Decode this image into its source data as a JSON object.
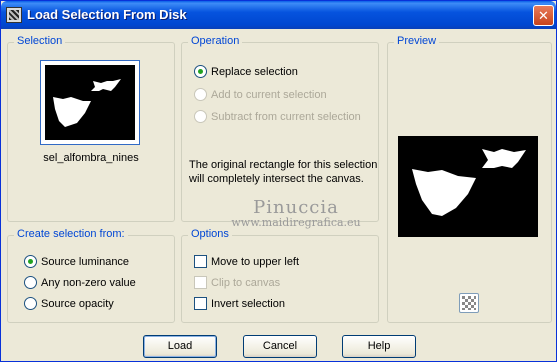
{
  "window": {
    "title": "Load Selection From Disk",
    "close_label": "✕"
  },
  "selection": {
    "title": "Selection",
    "filename": "sel_alfombra_nines"
  },
  "operation": {
    "title": "Operation",
    "options": [
      {
        "label": "Replace selection",
        "checked": true,
        "enabled": true
      },
      {
        "label": "Add to current selection",
        "checked": false,
        "enabled": false
      },
      {
        "label": "Subtract from current selection",
        "checked": false,
        "enabled": false
      }
    ],
    "info_line1": "The original rectangle for this selection",
    "info_line2": "will completely intersect the canvas."
  },
  "preview": {
    "title": "Preview"
  },
  "create_from": {
    "title": "Create selection from:",
    "options": [
      {
        "label": "Source luminance",
        "checked": true
      },
      {
        "label": "Any non-zero value",
        "checked": false
      },
      {
        "label": "Source opacity",
        "checked": false
      }
    ]
  },
  "options": {
    "title": "Options",
    "items": [
      {
        "label": "Move to upper left",
        "checked": false,
        "enabled": true
      },
      {
        "label": "Clip to canvas",
        "checked": false,
        "enabled": false
      },
      {
        "label": "Invert selection",
        "checked": false,
        "enabled": true
      }
    ]
  },
  "watermark": {
    "line1": "Pinuccia",
    "line2": "www.maidiregrafica.eu"
  },
  "buttons": {
    "load": "Load",
    "cancel": "Cancel",
    "help": "Help"
  },
  "colors": {
    "accent": "#0046d5",
    "titlebar": "#0653de",
    "radio_dot": "#21a121"
  }
}
